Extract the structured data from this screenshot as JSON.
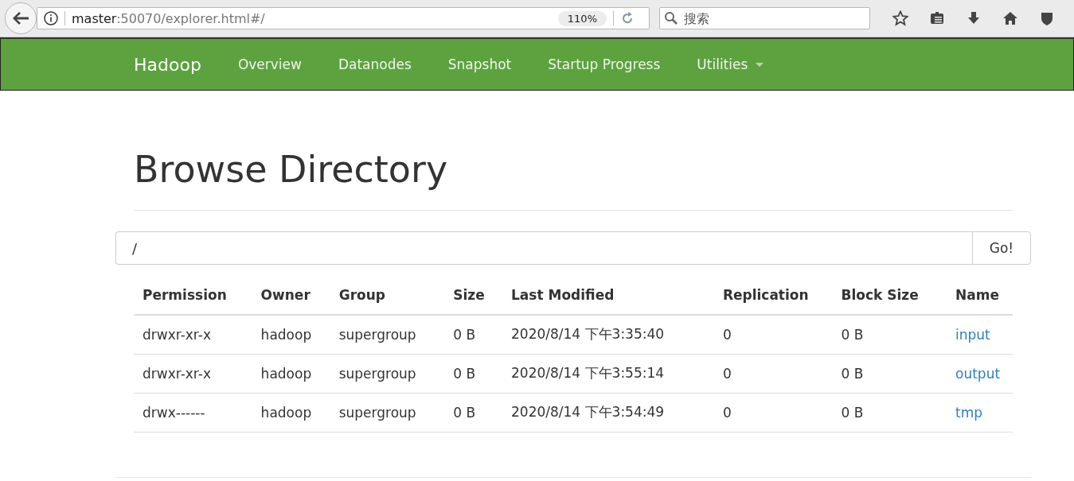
{
  "browser": {
    "url": "**master**:50070/explorer.html#/",
    "zoom": "110%",
    "search": {
      "placeholder": "搜索"
    }
  },
  "navbar": {
    "brand": "Hadoop",
    "items": [
      {
        "label": "Overview",
        "dropdown": false
      },
      {
        "label": "Datanodes",
        "dropdown": false
      },
      {
        "label": "Snapshot",
        "dropdown": false
      },
      {
        "label": "Startup Progress",
        "dropdown": false
      },
      {
        "label": "Utilities",
        "dropdown": true
      }
    ]
  },
  "page": {
    "title": "Browse Directory",
    "path_field": {
      "value": "/"
    },
    "go_button": "Go!"
  },
  "table": {
    "columns": [
      "Permission",
      "Owner",
      "Group",
      "Size",
      "Last Modified",
      "Replication",
      "Block Size",
      "Name"
    ],
    "rows": [
      {
        "cells": [
          "drwxr-xr-x",
          "hadoop",
          "supergroup",
          "0 B",
          "2020/8/14 下午3:35:40",
          "0",
          "0 B"
        ],
        "name": "input"
      },
      {
        "cells": [
          "drwxr-xr-x",
          "hadoop",
          "supergroup",
          "0 B",
          "2020/8/14 下午3:55:14",
          "0",
          "0 B"
        ],
        "name": "output"
      },
      {
        "cells": [
          "drwx------",
          "hadoop",
          "supergroup",
          "0 B",
          "2020/8/14 下午3:54:49",
          "0",
          "0 B"
        ],
        "name": "tmp"
      }
    ]
  }
}
